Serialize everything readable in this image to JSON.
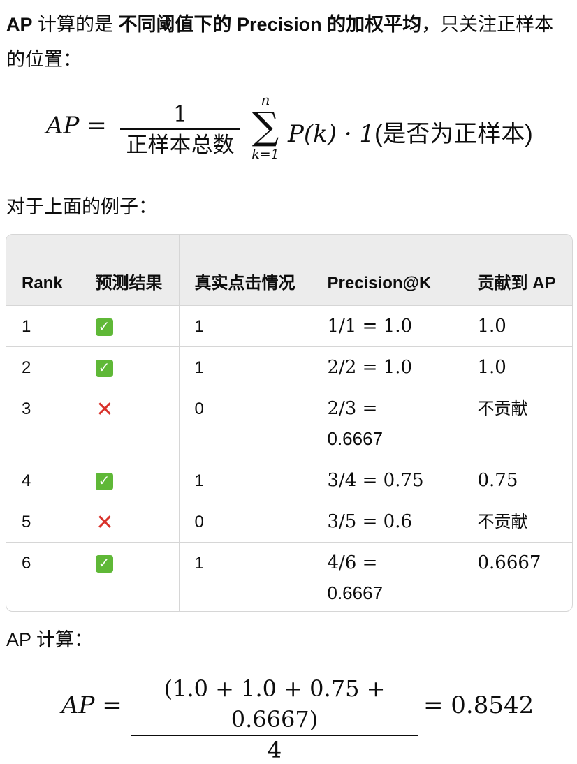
{
  "intro": {
    "lead": "AP",
    "mid": " 计算的是 ",
    "bold_phrase": "不同阈值下的 Precision 的加权平均",
    "tail": "，只关注正样本的位置："
  },
  "formula_main": {
    "lhs": "AP =",
    "numerator": "1",
    "denominator": "正样本总数",
    "sum_upper": "n",
    "sum_symbol": "∑",
    "sum_lower": "k=1",
    "term": "P(k) · 1",
    "indicator": "(是否为正样本)"
  },
  "example_intro": "对于上面的例子：",
  "table": {
    "headers": [
      "Rank",
      "预测结果",
      "真实点击情况",
      "Precision@K",
      "贡献到 AP"
    ],
    "rows": [
      {
        "rank": "1",
        "pred": "check",
        "truth": "1",
        "precision": "1/1 = 1.0",
        "contribution": "1.0",
        "contrib_plain": false
      },
      {
        "rank": "2",
        "pred": "check",
        "truth": "1",
        "precision": "2/2 = 1.0",
        "contribution": "1.0",
        "contrib_plain": false
      },
      {
        "rank": "3",
        "pred": "cross",
        "truth": "0",
        "precision": "2/3 =",
        "precision_tail": "0.6667",
        "contribution": "不贡献",
        "contrib_plain": true
      },
      {
        "rank": "4",
        "pred": "check",
        "truth": "1",
        "precision": "3/4 = 0.75",
        "contribution": "0.75",
        "contrib_plain": false
      },
      {
        "rank": "5",
        "pred": "cross",
        "truth": "0",
        "precision": "3/5 = 0.6",
        "contribution": "不贡献",
        "contrib_plain": true
      },
      {
        "rank": "6",
        "pred": "check",
        "truth": "1",
        "precision": "4/6 =",
        "precision_tail": "0.6667",
        "contribution": "0.6667",
        "contrib_plain": false
      }
    ],
    "icons": {
      "check": "check-mark-icon",
      "cross": "cross-mark-icon"
    },
    "colors": {
      "check_bg": "#5fb837",
      "cross": "#d9322b",
      "header_bg": "#ececec"
    }
  },
  "ap_label": "AP 计算：",
  "formula_result": {
    "lhs": "AP =",
    "numerator": "(1.0 + 1.0 + 0.75 + 0.6667)",
    "denominator": "4",
    "result": "= 0.8542"
  }
}
